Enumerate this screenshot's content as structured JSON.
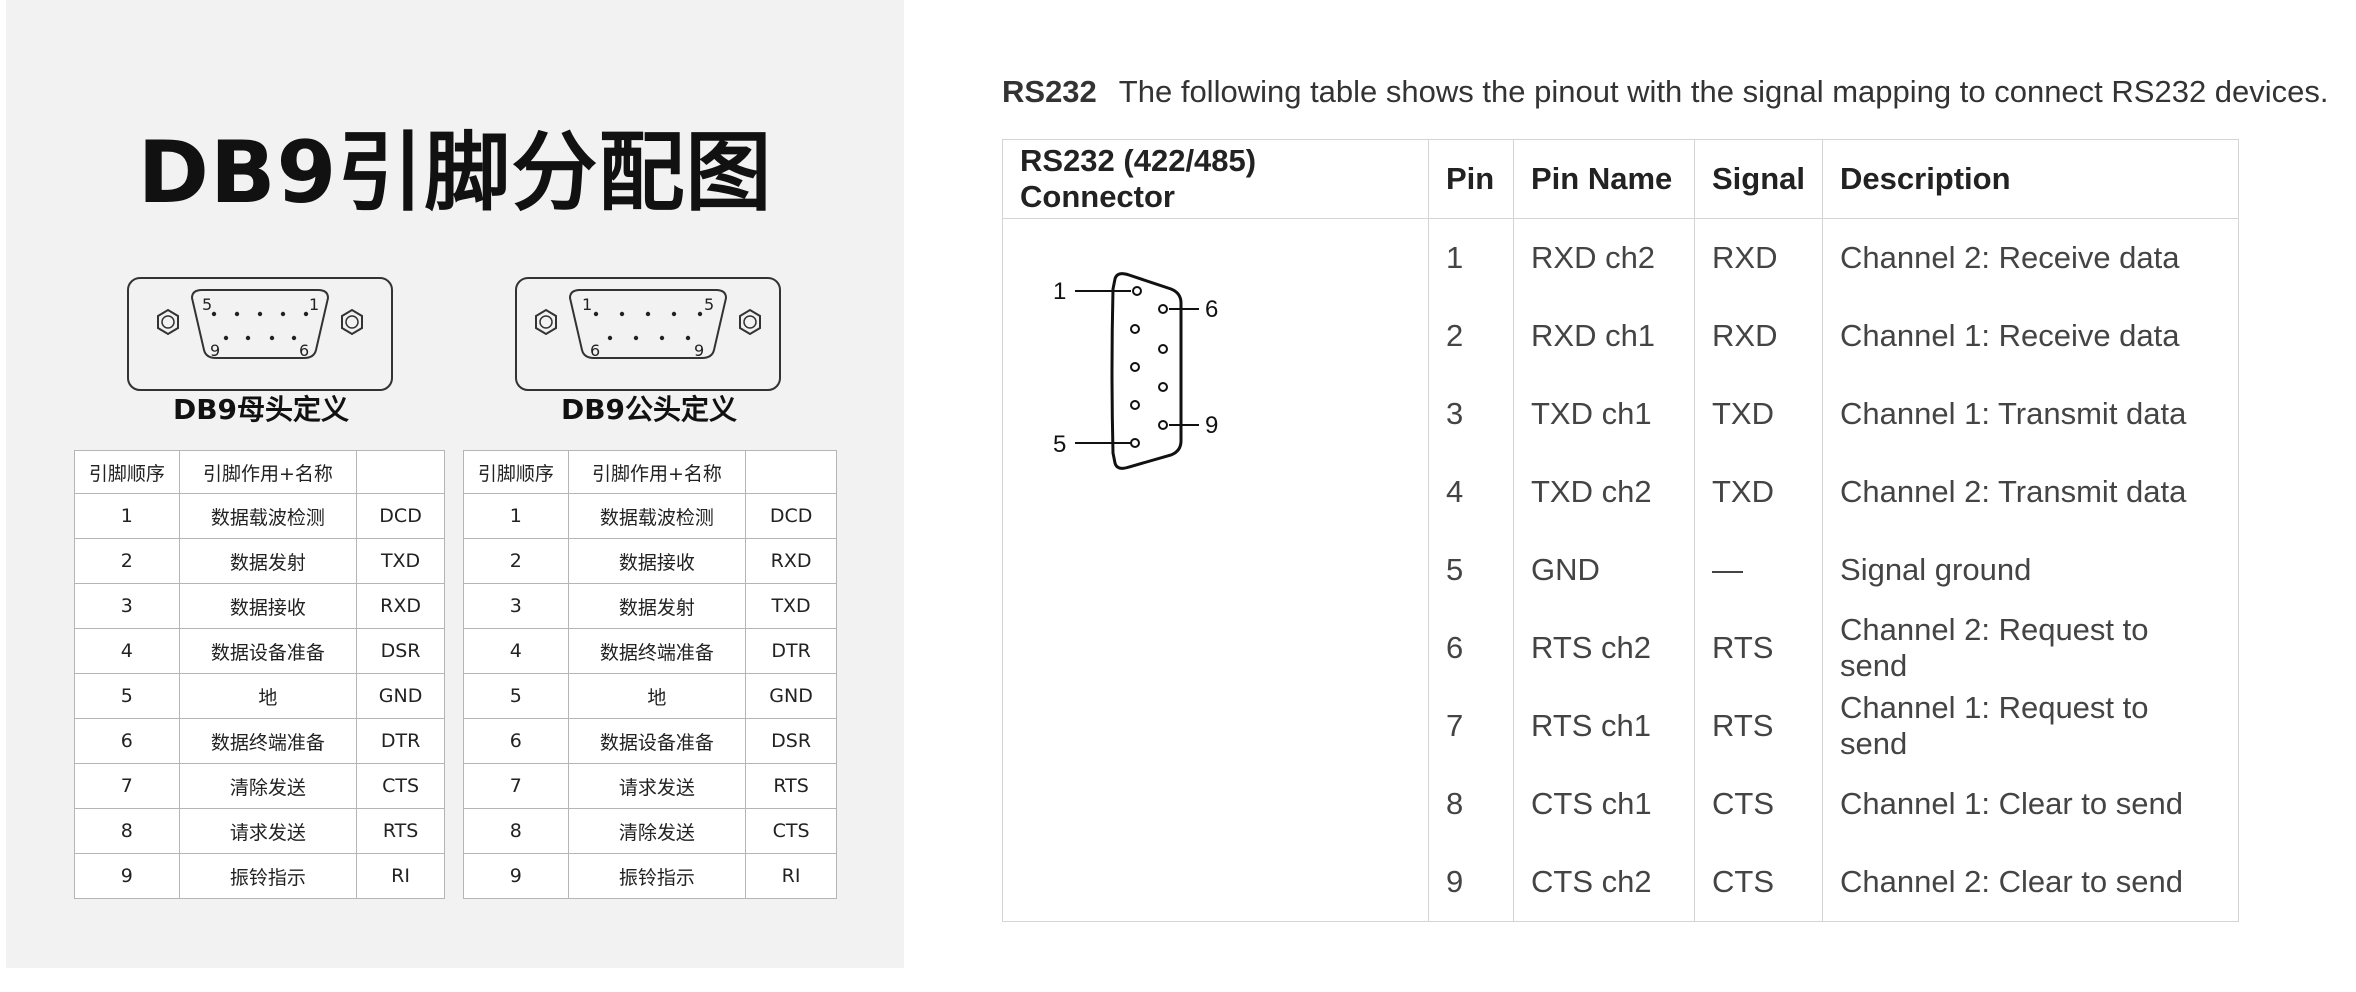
{
  "left": {
    "title": "DB9引脚分配图",
    "female": {
      "label": "DB9母头定义",
      "pin_labels": {
        "top_left": "5",
        "top_right": "1",
        "bottom_left": "9",
        "bottom_right": "6"
      }
    },
    "male": {
      "label": "DB9公头定义",
      "pin_labels": {
        "top_left": "1",
        "top_right": "5",
        "bottom_left": "6",
        "bottom_right": "9"
      }
    },
    "table_headers": [
      "引脚顺序",
      "引脚作用+名称",
      ""
    ],
    "female_rows": [
      [
        "1",
        "数据载波检测",
        "DCD"
      ],
      [
        "2",
        "数据发射",
        "TXD"
      ],
      [
        "3",
        "数据接收",
        "RXD"
      ],
      [
        "4",
        "数据设备准备",
        "DSR"
      ],
      [
        "5",
        "地",
        "GND"
      ],
      [
        "6",
        "数据终端准备",
        "DTR"
      ],
      [
        "7",
        "清除发送",
        "CTS"
      ],
      [
        "8",
        "请求发送",
        "RTS"
      ],
      [
        "9",
        "振铃指示",
        "RI"
      ]
    ],
    "male_rows": [
      [
        "1",
        "数据载波检测",
        "DCD"
      ],
      [
        "2",
        "数据接收",
        "RXD"
      ],
      [
        "3",
        "数据发射",
        "TXD"
      ],
      [
        "4",
        "数据终端准备",
        "DTR"
      ],
      [
        "5",
        "地",
        "GND"
      ],
      [
        "6",
        "数据设备准备",
        "DSR"
      ],
      [
        "7",
        "请求发送",
        "RTS"
      ],
      [
        "8",
        "清除发送",
        "CTS"
      ],
      [
        "9",
        "振铃指示",
        "RI"
      ]
    ]
  },
  "right": {
    "intro_tag": "RS232",
    "intro_text": "The following table shows the pinout with the signal mapping to connect RS232 devices.",
    "headers": [
      "RS232 (422/485) Connector",
      "Pin",
      "Pin Name",
      "Signal",
      "Description"
    ],
    "diagram_labels": {
      "pin1": "1",
      "pin5": "5",
      "pin6": "6",
      "pin9": "9"
    },
    "rows": [
      [
        "1",
        "RXD ch2",
        "RXD",
        "Channel 2: Receive data"
      ],
      [
        "2",
        "RXD ch1",
        "RXD",
        "Channel 1: Receive data"
      ],
      [
        "3",
        "TXD ch1",
        "TXD",
        "Channel 1: Transmit data"
      ],
      [
        "4",
        "TXD ch2",
        "TXD",
        "Channel 2: Transmit data"
      ],
      [
        "5",
        "GND",
        "—",
        "Signal ground"
      ],
      [
        "6",
        "RTS ch2",
        "RTS",
        "Channel 2: Request to send"
      ],
      [
        "7",
        "RTS ch1",
        "RTS",
        "Channel 1: Request to send"
      ],
      [
        "8",
        "CTS ch1",
        "CTS",
        "Channel 1: Clear to send"
      ],
      [
        "9",
        "CTS ch2",
        "CTS",
        "Channel 2: Clear to send"
      ]
    ]
  }
}
